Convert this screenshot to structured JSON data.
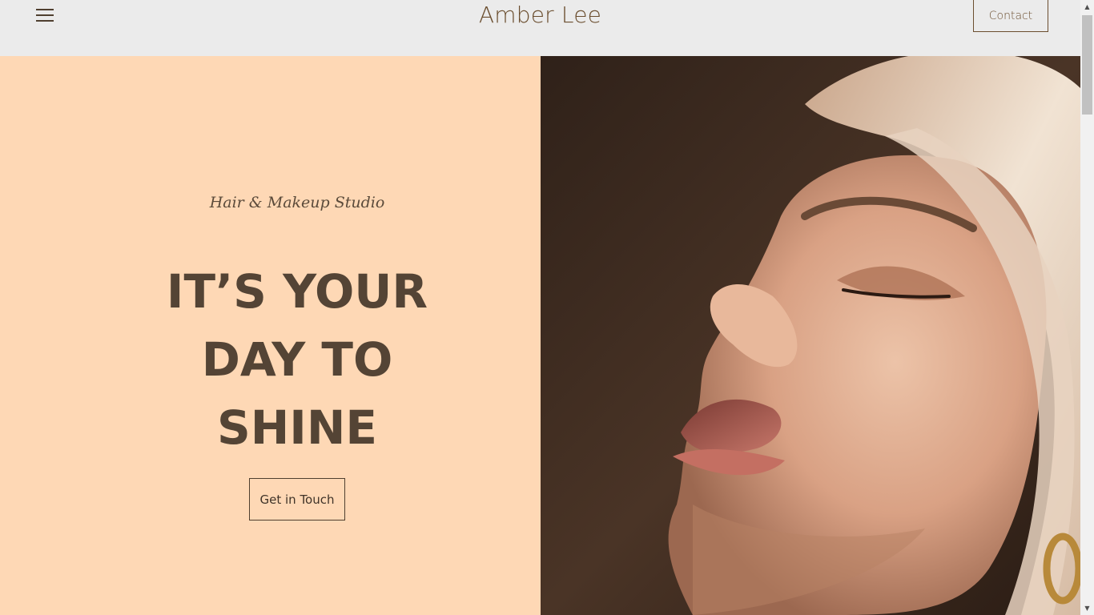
{
  "header": {
    "brand": "Amber Lee",
    "contact_label": "Contact",
    "menu_icon": "hamburger-menu-icon"
  },
  "hero": {
    "tagline": "Hair & Makeup Studio",
    "headline_lines": [
      "IT’S YOUR",
      "DAY TO",
      "SHINE"
    ],
    "cta_label": "Get in Touch",
    "image_alt": "portrait-photo",
    "colors": {
      "panel_background": "#fed8b5",
      "text_dark": "#544435",
      "accent_brown": "#6b4e2f",
      "header_background": "#ebebeb"
    }
  },
  "scrollbar": {
    "up_icon": "scroll-up-arrow-icon",
    "down_icon": "scroll-down-arrow-icon"
  }
}
